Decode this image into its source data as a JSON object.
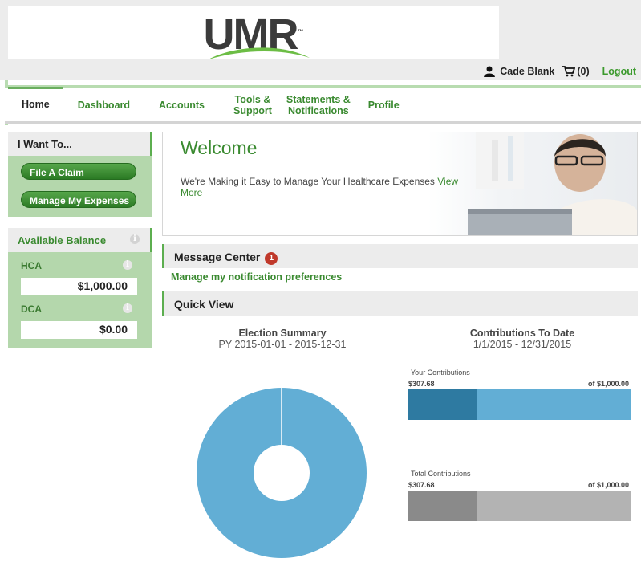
{
  "header": {
    "logo_text": "UMR",
    "logo_tm": "™",
    "user_name": "Cade Blank",
    "cart_count": "(0)",
    "logout": "Logout"
  },
  "nav": {
    "items": [
      {
        "label": "Home",
        "active": true
      },
      {
        "label": "Dashboard"
      },
      {
        "label": "Accounts"
      },
      {
        "label": "Tools &",
        "label2": "Support"
      },
      {
        "label": "Statements &",
        "label2": "Notifications"
      },
      {
        "label": "Profile"
      }
    ]
  },
  "sidebar": {
    "iwant_title": "I Want To...",
    "buttons": [
      "File A Claim",
      "Manage My Expenses"
    ],
    "balance_title": "Available Balance",
    "accounts": [
      {
        "label": "HCA",
        "value": "$1,000.00"
      },
      {
        "label": "DCA",
        "value": "$0.00"
      }
    ]
  },
  "welcome": {
    "title": "Welcome",
    "text": "We're Making it Easy to Manage Your Healthcare Expenses",
    "link": "View More"
  },
  "message_center": {
    "title": "Message Center",
    "badge": "1",
    "link": "Manage my notification preferences"
  },
  "quick_view": {
    "title": "Quick View",
    "election": {
      "title": "Election Summary",
      "subtitle": "PY 2015-01-01 - 2015-12-31"
    },
    "contributions": {
      "title": "Contributions To Date",
      "subtitle": "1/1/2015 - 12/31/2015",
      "your_label": "Your Contributions",
      "your_amount": "$307.68",
      "your_total": "of $1,000.00",
      "total_label": "Total Contributions",
      "total_amount": "$307.68",
      "total_total": "of $1,000.00"
    }
  },
  "chart_data": [
    {
      "type": "pie",
      "title": "Election Summary",
      "subtitle": "PY 2015-01-01 - 2015-12-31",
      "values": [
        1000
      ],
      "colors": [
        "#62aed5"
      ]
    },
    {
      "type": "bar",
      "title": "Contributions To Date",
      "subtitle": "1/1/2015 - 12/31/2015",
      "categories": [
        "Your Contributions",
        "Total Contributions"
      ],
      "values": [
        307.68,
        307.68
      ],
      "max": 1000,
      "colors": {
        "your_filled": "#2e7aa1",
        "your_rest": "#62aed5",
        "total_filled": "#8a8a8a",
        "total_rest": "#b3b3b3"
      }
    }
  ]
}
